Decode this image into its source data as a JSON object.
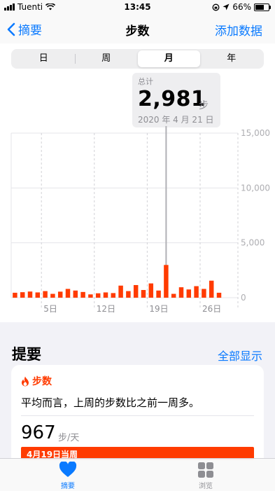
{
  "status_bar": {
    "carrier": "Tuenti",
    "time": "13:45",
    "battery": "66%",
    "battery_level": 0.66
  },
  "nav": {
    "back_label": "摘要",
    "title": "步数",
    "action_label": "添加数据"
  },
  "segments": [
    "日",
    "周",
    "月",
    "年"
  ],
  "selected_segment": "月",
  "tooltip": {
    "label": "总计",
    "value": "2,981",
    "unit": "步",
    "date": "2020 年 4 月 21 日"
  },
  "chart_data": {
    "type": "bar",
    "x": [
      1,
      2,
      3,
      4,
      5,
      6,
      7,
      8,
      9,
      10,
      11,
      12,
      13,
      14,
      15,
      16,
      17,
      18,
      19,
      20,
      21,
      22,
      23,
      24,
      25,
      26,
      27,
      28,
      29,
      30
    ],
    "x_tick_labels": [
      "5日",
      "12日",
      "19日",
      "26日"
    ],
    "x_tick_positions": [
      5,
      12,
      19,
      26
    ],
    "y_tick_labels": [
      "15,000",
      "10,000",
      "5,000",
      "0"
    ],
    "ylim": [
      0,
      15000
    ],
    "highlighted_day": 21,
    "values": [
      450,
      500,
      560,
      480,
      600,
      350,
      550,
      800,
      650,
      520,
      300,
      400,
      480,
      420,
      1100,
      600,
      1150,
      700,
      1300,
      650,
      2981,
      350,
      950,
      750,
      1050,
      800,
      1550,
      450,
      0,
      0
    ]
  },
  "summary": {
    "header": "提要",
    "show_all": "全部显示",
    "category": "步数",
    "text": "平均而言，上周的步数比之前一周多。",
    "value": "967",
    "unit": "步/天",
    "bar_label": "4月19日当周"
  },
  "tabs": [
    {
      "label": "摘要",
      "icon": "heart-icon",
      "active": true
    },
    {
      "label": "浏览",
      "icon": "grid-icon",
      "active": false
    }
  ],
  "colors": {
    "accent": "#0a7aff",
    "bar": "#ff3b00"
  }
}
